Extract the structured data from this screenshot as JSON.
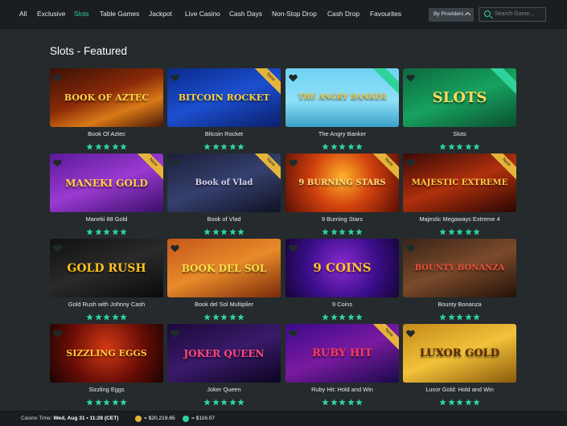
{
  "nav": {
    "items": [
      {
        "label": "All",
        "active": false
      },
      {
        "label": "Exclusive",
        "active": false
      },
      {
        "label": "Slots",
        "active": true
      },
      {
        "label": "Table Games",
        "active": false
      },
      {
        "label": "Jackpot",
        "active": false
      },
      {
        "label": "Live Casino",
        "active": false
      },
      {
        "label": "Cash Days",
        "active": false
      },
      {
        "label": "Non-Stop Drop",
        "active": false
      },
      {
        "label": "Cash Drop",
        "active": false
      },
      {
        "label": "Favourites",
        "active": false
      }
    ],
    "providers_label": "By Providers",
    "search_placeholder": "Search Game..."
  },
  "section_title": "Slots - Featured",
  "rating_stars": 5,
  "colors": {
    "accent": "#2fd39a",
    "new_ribbon": "#e6b43a",
    "star": "#2fd39a"
  },
  "games": [
    {
      "name": "Book Of Aztec",
      "art": "BOOK OF AZTEC",
      "ribbon": "",
      "bg": "linear-gradient(160deg,#3b1005 0%,#8a2a08 45%,#d97a17 70%,#4a1606 100%)",
      "art_color": "#ffd44a",
      "art_size": 11
    },
    {
      "name": "Bitcoin Rocket",
      "art": "BITCOIN ROCKET",
      "ribbon": "New",
      "bg": "linear-gradient(160deg,#0a2a8a 0%,#1c4fd0 50%,#0a1f6a 100%)",
      "art_color": "#ffd23a",
      "art_size": 11
    },
    {
      "name": "The Angry Banker",
      "art": "THE ANGRY BANKER",
      "ribbon": "green",
      "bg": "linear-gradient(180deg,#6fd2f4 0%,#8ee0f7 55%,#3aa1c9 100%)",
      "art_color": "#f7c33a",
      "art_size": 9
    },
    {
      "name": "Slots",
      "art": "SLOTS",
      "ribbon": "green",
      "bg": "linear-gradient(160deg,#0c6a3f 0%,#17a25f 50%,#0b4f30 100%)",
      "art_color": "#ffd85a",
      "art_size": 18
    },
    {
      "name": "Maneki 88 Gold",
      "art": "MANEKI GOLD",
      "ribbon": "New",
      "bg": "linear-gradient(160deg,#5a1a9a 0%,#9a3ad0 50%,#3a0f6a 100%)",
      "art_color": "#ffd33a",
      "art_size": 12
    },
    {
      "name": "Book of Vlad",
      "art": "Book of Vlad",
      "ribbon": "New",
      "bg": "linear-gradient(160deg,#1a1f3a 0%,#36406e 50%,#0f1224 100%)",
      "art_color": "#d8d2e8",
      "art_size": 10
    },
    {
      "name": "9 Burning Stars",
      "art": "9 BURNING STARS",
      "ribbon": "New",
      "bg": "radial-gradient(circle at 50% 40%,#ffb12a 0%,#d2420e 45%,#5a0d04 100%)",
      "art_color": "#ffe07a",
      "art_size": 10
    },
    {
      "name": "Majestic Megaways Extreme 4",
      "art": "MAJESTIC EXTREME",
      "ribbon": "New",
      "bg": "linear-gradient(160deg,#3a0a08 0%,#b0300c 50%,#2a0604 100%)",
      "art_color": "#ffc94a",
      "art_size": 10
    },
    {
      "name": "Gold Rush with Johnny Cash",
      "art": "GOLD RUSH",
      "ribbon": "",
      "bg": "linear-gradient(160deg,#111111 0%,#2a2a2a 50%,#0a0a0a 100%)",
      "art_color": "#ffc21a",
      "art_size": 14
    },
    {
      "name": "Book del Sol Multiplier",
      "art": "BOOK DEL SOL",
      "ribbon": "",
      "bg": "linear-gradient(160deg,#c4581a 0%,#e88a2a 50%,#7a2a0a 100%)",
      "art_color": "#ffe04a",
      "art_size": 12
    },
    {
      "name": "9 Coins",
      "art": "9 COINS",
      "ribbon": "",
      "bg": "radial-gradient(circle at 50% 45%,#8a2ad0 0%,#3a0e8a 55%,#160436 100%)",
      "art_color": "#ffc22a",
      "art_size": 15
    },
    {
      "name": "Bounty Bonanza",
      "art": "BOUNTY BONANZA",
      "ribbon": "",
      "bg": "linear-gradient(160deg,#3a2418 0%,#7a4a2a 50%,#241208 100%)",
      "art_color": "#e8503a",
      "art_size": 10
    },
    {
      "name": "Sizzling Eggs",
      "art": "SIZZLING EGGS",
      "ribbon": "",
      "bg": "radial-gradient(circle at 50% 40%,#d23a14 0%,#6a0d06 55%,#1a0402 100%)",
      "art_color": "#ffc93a",
      "art_size": 11
    },
    {
      "name": "Joker Queen",
      "art": "JOKER QUEEN",
      "ribbon": "",
      "bg": "linear-gradient(160deg,#1a0a3a 0%,#3a1a6a 50%,#0a0420 100%)",
      "art_color": "#ff4a7a",
      "art_size": 12
    },
    {
      "name": "Ruby Hit: Hold and Win",
      "art": "RUBY HIT",
      "ribbon": "New",
      "bg": "linear-gradient(160deg,#3a0a8a 0%,#7a1aa0 50%,#1a0a4a 100%)",
      "art_color": "#ff3a5a",
      "art_size": 13
    },
    {
      "name": "Luxor Gold: Hold and Win",
      "art": "LUXOR GOLD",
      "ribbon": "",
      "bg": "linear-gradient(160deg,#c48a1a 0%,#f2c23a 50%,#8a5a0a 100%)",
      "art_color": "#5a2a08",
      "art_size": 13
    }
  ],
  "footer": {
    "time_label": "Casino Time:",
    "time_value": "Wed, Aug 31 • 11:28 (CET)",
    "balance_gold": "= $20,219.65",
    "balance_green": "= $116.07"
  }
}
